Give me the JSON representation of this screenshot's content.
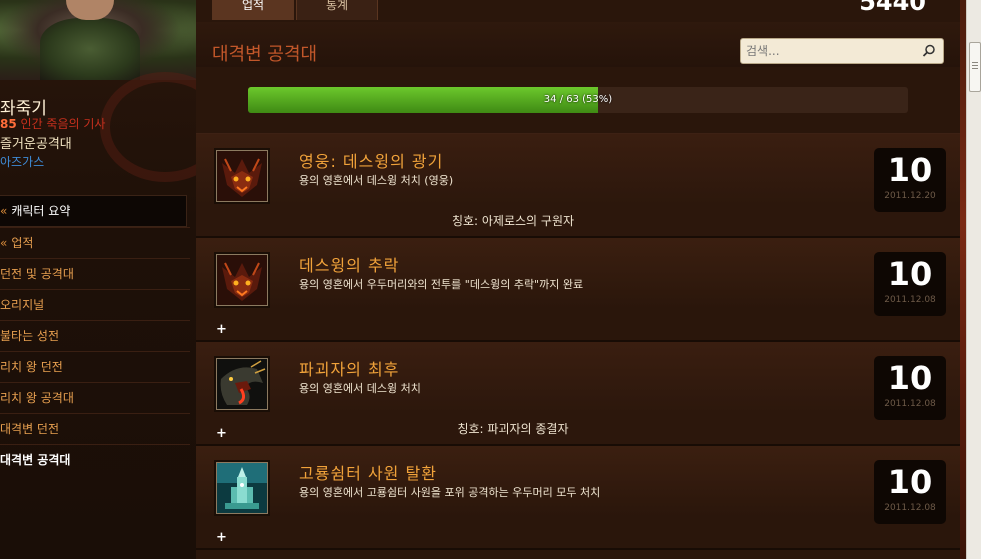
{
  "character": {
    "name": "좌죽기",
    "level": "85",
    "class_text": "인간 죽음의 기사",
    "guild": "즐거운공격대",
    "realm": "아즈가스"
  },
  "nav": {
    "items": [
      {
        "label": "캐릭터 요약",
        "mark": "«"
      },
      {
        "label": "업적",
        "mark": "«"
      },
      {
        "label": "던전 및 공격대"
      },
      {
        "label": "오리지널"
      },
      {
        "label": "불타는 성전"
      },
      {
        "label": "리치 왕 던전"
      },
      {
        "label": "리치 왕 공격대"
      },
      {
        "label": "대격변 던전"
      },
      {
        "label": "대격변 공격대"
      }
    ]
  },
  "tabs": [
    {
      "label": "업적"
    },
    {
      "label": "통계"
    }
  ],
  "points_total": "5440",
  "section_title": "대격변 공격대",
  "search": {
    "placeholder": "검색..."
  },
  "progress": {
    "label": "34 / 63 (53%)",
    "value": 0.53
  },
  "achievements": [
    {
      "title": "영웅: 데스윙의 광기",
      "desc": "용의 영혼에서 데스윙 처치 (영웅)",
      "reward": "칭호: 아제로스의 구원자",
      "points": "10",
      "date": "2011.12.20",
      "expand": ""
    },
    {
      "title": "데스윙의 추락",
      "desc": "용의 영혼에서 우두머리와의 전투를 \"데스윙의 추락\"까지 완료",
      "reward": "",
      "points": "10",
      "date": "2011.12.08",
      "expand": "+"
    },
    {
      "title": "파괴자의 최후",
      "desc": "용의 영혼에서 데스윙 처치",
      "reward": "칭호: 파괴자의 종결자",
      "points": "10",
      "date": "2011.12.08",
      "expand": "+"
    },
    {
      "title": "고룡쉼터 사원 탈환",
      "desc": "용의 영혼에서 고룡쉼터 사원을 포위 공격하는 우두머리 모두 처치",
      "reward": "",
      "points": "10",
      "date": "2011.12.08",
      "expand": "+"
    }
  ],
  "colors": {
    "accent": "#f0a23a",
    "progress_fill": "#5cb822",
    "title_red": "#c2572a"
  }
}
